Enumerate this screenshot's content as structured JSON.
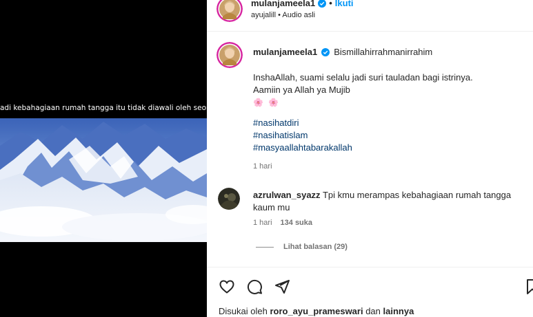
{
  "video": {
    "caption": "adi kebahagiaan rumah tangga itu tidak diawali oleh seorang istri"
  },
  "header": {
    "username": "mulanjameela1",
    "dot": "•",
    "follow_label": "Ikuti",
    "subtitle": "ayujalill • Audio asli"
  },
  "post_caption": {
    "username": "mulanjameela1",
    "first_line": "Bismillahirrahmanirrahim",
    "line2": "InshaAllah, suami selalu jadi suri tauladan bagi istrinya.",
    "line3": "Aamiin ya Allah ya Mujib",
    "flowers": "🌸 🌸",
    "hashtags": [
      "#nasihatdiri",
      "#nasihatislam",
      "#masyaallahtabarakallah"
    ],
    "time": "1 hari"
  },
  "comment": {
    "username": "azrulwan_syazz",
    "text": "Tpi kmu merampas kebahagiaan rumah tangga kaum mu",
    "time": "1 hari",
    "likes": "134 suka",
    "replies_label": "Lihat balasan (29)"
  },
  "footer": {
    "liked_by_prefix": "Disukai oleh",
    "liked_by_user": "roro_ayu_prameswari",
    "liked_by_and": "dan",
    "liked_by_others": "lainnya"
  },
  "colors": {
    "accent": "#0095f6",
    "hashtag": "#00376b",
    "muted": "#737373",
    "verified": "#0095f6"
  },
  "icons": [
    "verified-icon",
    "heart-icon",
    "comment-icon",
    "share-icon",
    "bookmark-icon"
  ]
}
